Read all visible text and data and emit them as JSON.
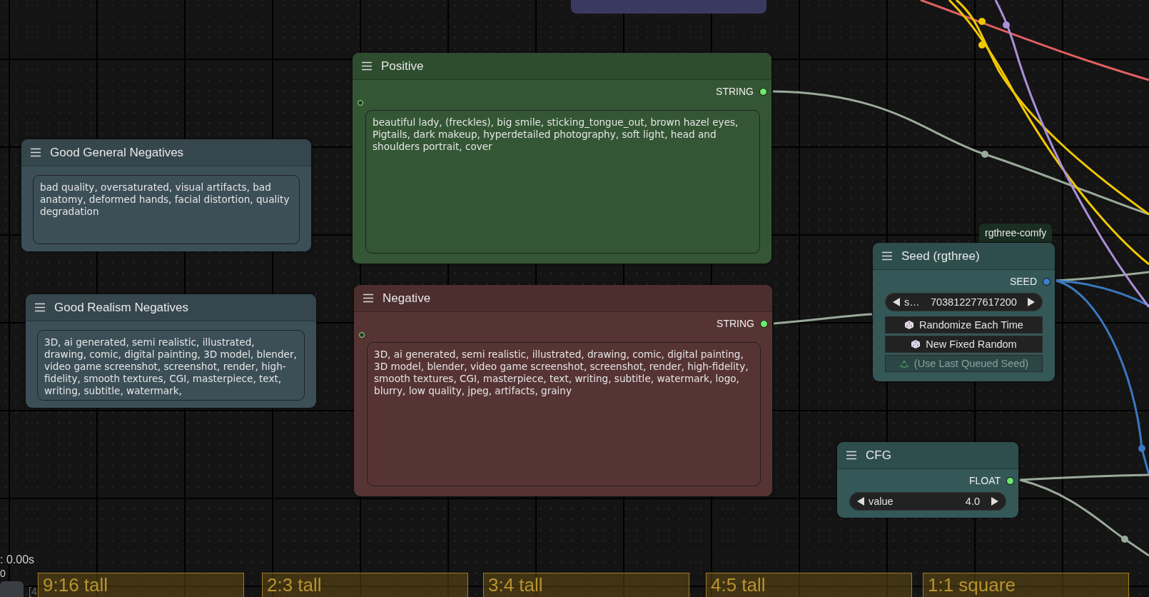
{
  "nodes": [
    {
      "kind": "text",
      "title": "Good General Negatives",
      "color": "#3c4f57",
      "text": "bad quality, oversaturated, visual artifacts, bad anatomy, deformed hands, facial distortion, quality degradation"
    },
    {
      "kind": "text",
      "title": "Good Realism Negatives",
      "color": "#3c4f57",
      "text": "3D, ai generated, semi realistic, illustrated, drawing, comic, digital painting, 3D model, blender, video game screenshot, screenshot, render, high-fidelity, smooth textures, CGI, masterpiece, text, writing, subtitle, watermark,"
    },
    {
      "kind": "text",
      "title": "Positive",
      "color": "#345634",
      "output": {
        "label": "STRING",
        "color": "#6fe86f"
      },
      "text": "beautiful lady, (freckles), big smile, sticking_tongue_out, brown hazel eyes, Pigtails, dark makeup, hyperdetailed photography, soft light, head and shoulders portrait, cover"
    },
    {
      "kind": "text",
      "title": "Negative",
      "color": "#573434",
      "output": {
        "label": "STRING",
        "color": "#6fe86f"
      },
      "text": "3D, ai generated, semi realistic, illustrated, drawing, comic, digital painting, 3D model, blender, video game screenshot, screenshot, render, high-fidelity, smooth textures, CGI, masterpiece, text, writing, subtitle, watermark, logo, blurry, low quality, jpeg, artifacts, grainy"
    },
    {
      "kind": "seed",
      "title": "Seed (rgthree)",
      "badge": "rgthree-comfy",
      "color": "#345757",
      "output": {
        "label": "SEED",
        "color": "#3a7fd0"
      },
      "label": "s…",
      "value": "703812277617200",
      "buttons": [
        {
          "kind": "randomize",
          "label": "Randomize Each Time",
          "disabled": false
        },
        {
          "kind": "new-fixed",
          "label": "New Fixed Random",
          "disabled": false
        },
        {
          "kind": "use-last",
          "label": "(Use Last Queued Seed)",
          "disabled": true
        }
      ]
    },
    {
      "kind": "number",
      "title": "CFG",
      "color": "#345757",
      "output": {
        "label": "FLOAT",
        "color": "#6fe86f"
      },
      "label": "value",
      "value": "4.0"
    }
  ],
  "groups": [
    {
      "title": "9:16 tall"
    },
    {
      "title": "2:3 tall"
    },
    {
      "title": "3:4 tall"
    },
    {
      "title": "4:5 tall"
    },
    {
      "title": "1:1 square"
    }
  ],
  "status": {
    "time": ": 0.00s",
    "count": "0",
    "queue": "[4"
  }
}
